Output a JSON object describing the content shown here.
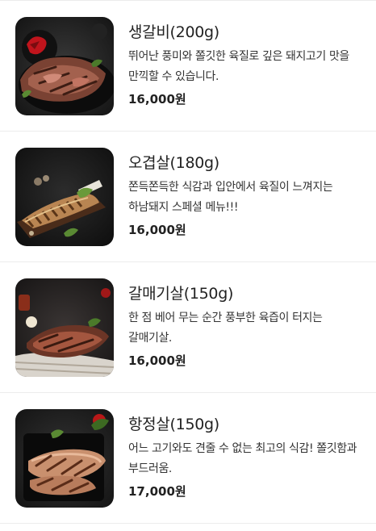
{
  "menu": {
    "items": [
      {
        "name": "생갈비(200g)",
        "description": "뛰어난 풍미와 쫄깃한 육질로 깊은 돼지고기 맛을 만끽할 수 있습니다.",
        "price": "16,000원",
        "image": "grilled-pork-ribs-photo"
      },
      {
        "name": "오겹살(180g)",
        "description": "쫀득쫀득한 식감과 입안에서 육질이 느껴지는 하남돼지 스페셜 메뉴!!!",
        "price": "16,000원",
        "image": "grilled-pork-belly-photo"
      },
      {
        "name": "갈매기살(150g)",
        "description": "한 점 베어 무는 순간 풍부한 육즙이 터지는 갈매기살.",
        "price": "16,000원",
        "image": "grilled-skirt-meat-photo"
      },
      {
        "name": "항정살(150g)",
        "description": "어느 고기와도 견줄 수 없는 최고의 식감! 쫄깃함과 부드러움.",
        "price": "17,000원",
        "image": "grilled-pork-jowl-photo"
      }
    ]
  }
}
